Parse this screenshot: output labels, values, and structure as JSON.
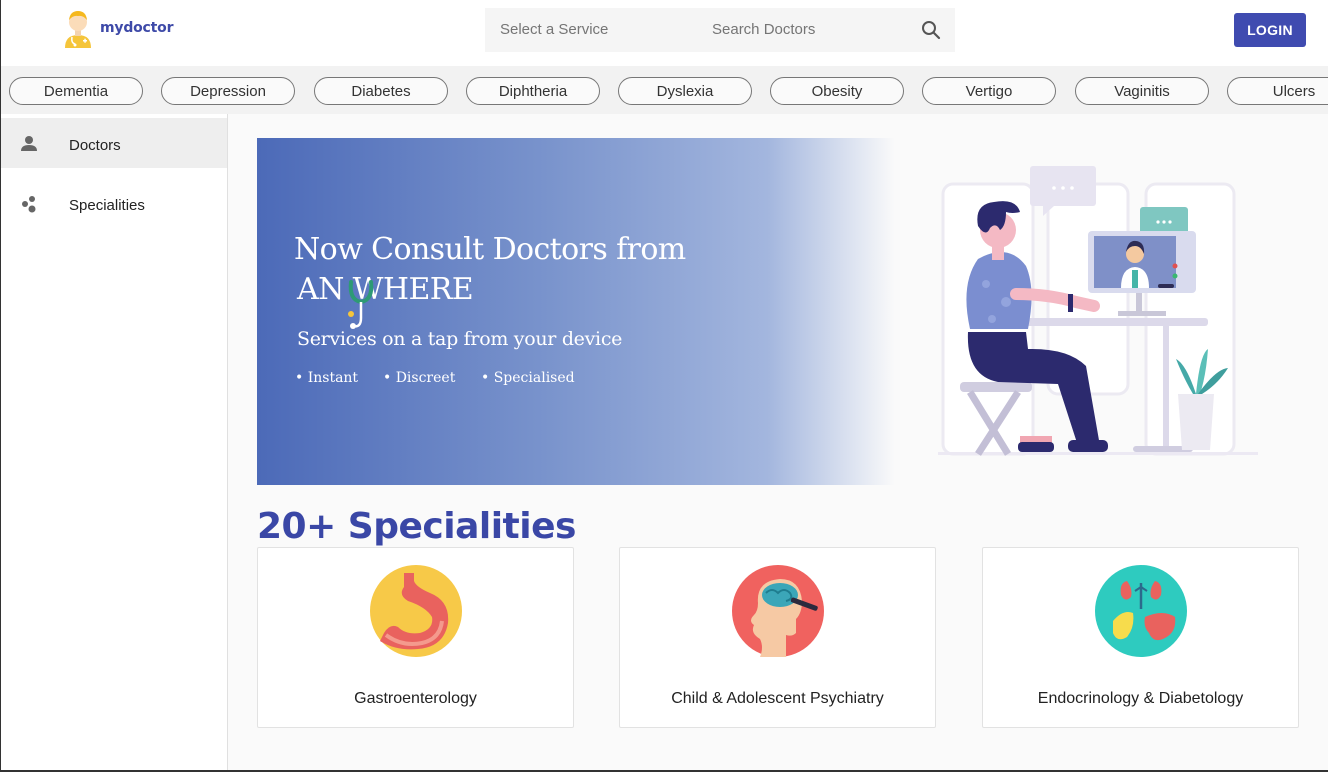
{
  "header": {
    "logo_text": "mydoctor",
    "search_service_placeholder": "Select a Service",
    "search_doctors_placeholder": "Search Doctors",
    "login_label": "LOGIN"
  },
  "chips": [
    "Dementia",
    "Depression",
    "Diabetes",
    "Diphtheria",
    "Dyslexia",
    "Obesity",
    "Vertigo",
    "Vaginitis",
    "Ulcers"
  ],
  "sidebar": {
    "items": [
      {
        "label": "Doctors",
        "icon": "person-icon",
        "active": true
      },
      {
        "label": "Specialities",
        "icon": "bubbles-icon",
        "active": false
      }
    ]
  },
  "banner": {
    "title_line1": "Now Consult Doctors from",
    "title_line2": "AN  WHERE",
    "subtitle": "Services on a tap from your device",
    "bullets": [
      "• Instant",
      "• Discreet",
      "• Specialised"
    ]
  },
  "specialities": {
    "heading": "20+ Specialities",
    "cards": [
      {
        "label": "Gastroenterology",
        "icon": "stomach-icon",
        "color": "#f7c948"
      },
      {
        "label": "Child & Adolescent Psychiatry",
        "icon": "brain-icon",
        "color": "#f0625f"
      },
      {
        "label": "Endocrinology & Diabetology",
        "icon": "organs-icon",
        "color": "#2ecbbf"
      }
    ]
  },
  "colors": {
    "accent": "#3f4bb0",
    "heading": "#3a47a6"
  }
}
